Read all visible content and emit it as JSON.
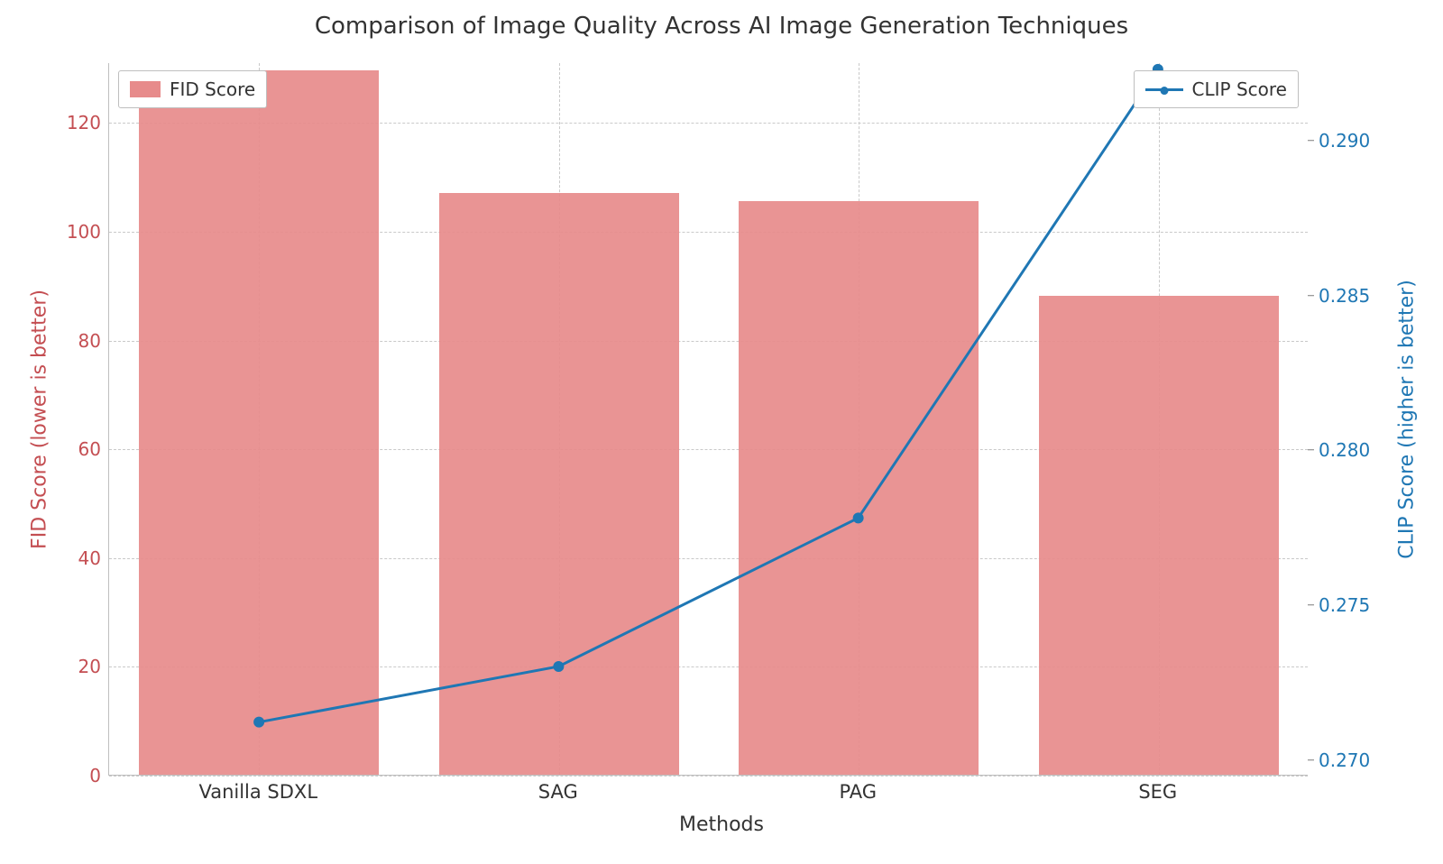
{
  "chart_data": {
    "type": "bar",
    "title": "Comparison of Image Quality Across AI Image Generation Techniques",
    "xlabel": "Methods",
    "categories": [
      "Vanilla SDXL",
      "SAG",
      "PAG",
      "SEG"
    ],
    "left_axis": {
      "label": "FID Score (lower is better)",
      "ticks": [
        0,
        20,
        40,
        60,
        80,
        100,
        120
      ],
      "range": [
        0,
        131
      ],
      "color": "#c44e52"
    },
    "right_axis": {
      "label": "CLIP Score (higher is better)",
      "ticks": [
        0.27,
        0.275,
        0.28,
        0.285,
        0.29
      ],
      "range": [
        0.2695,
        0.2925
      ],
      "color": "#1f77b4"
    },
    "series": [
      {
        "name": "FID Score",
        "axis": "left",
        "style": "bar",
        "values": [
          129.5,
          107,
          105.5,
          88
        ]
      },
      {
        "name": "CLIP Score",
        "axis": "right",
        "style": "line",
        "values": [
          0.2712,
          0.273,
          0.2778,
          0.2923
        ]
      }
    ],
    "legend_left": {
      "label": "FID Score"
    },
    "legend_right": {
      "label": "CLIP Score"
    }
  }
}
